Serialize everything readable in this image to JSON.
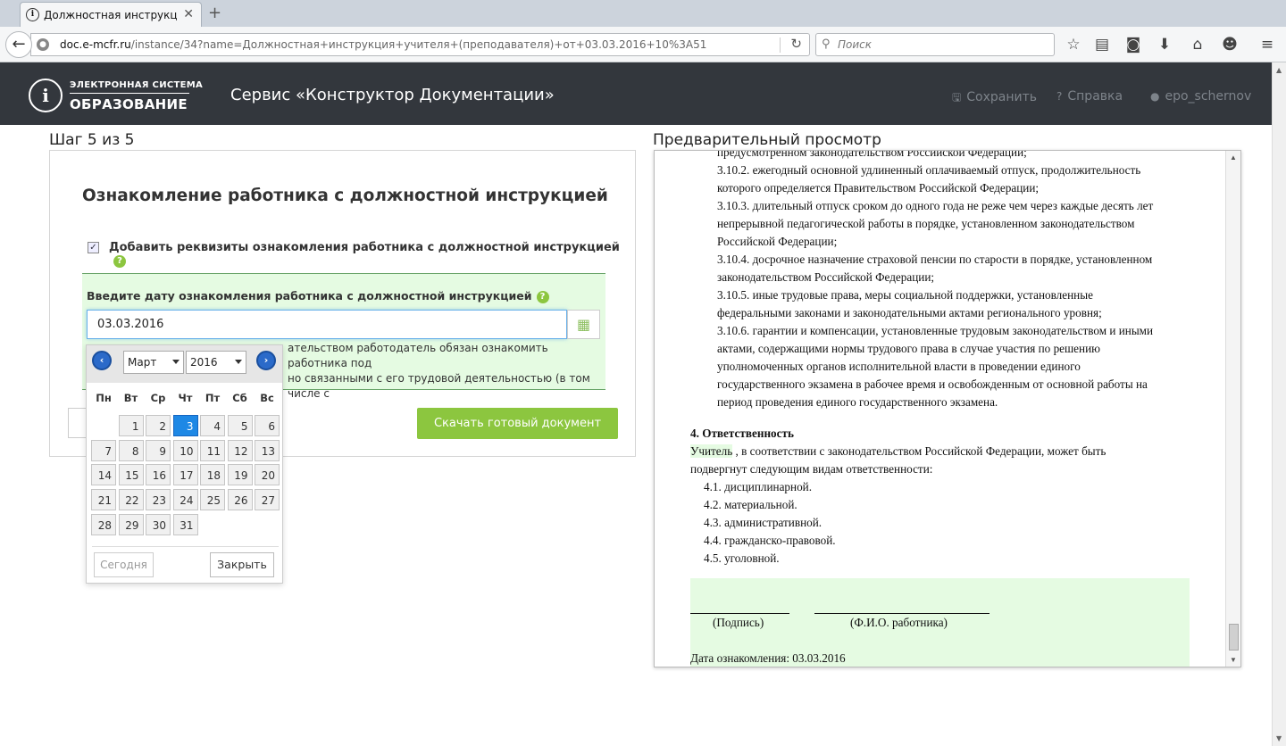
{
  "browser": {
    "tab_title": "Должностная инструкция...",
    "url_domain": "doc.e-mcfr.ru",
    "url_path": "/instance/34?name=Должностная+инструкция+учителя+(преподавателя)+от+03.03.2016+10%3A51",
    "search_placeholder": "Поиск"
  },
  "header": {
    "logo_top": "ЭЛЕКТРОННАЯ СИСТЕМА",
    "logo_bottom": "ОБРАЗОВАНИЕ",
    "service_title": "Сервис «Конструктор Документации»",
    "save": "Сохранить",
    "help": "Справка",
    "user": "epo_schernov"
  },
  "wizard": {
    "step": "Шаг 5 из 5",
    "title": "Ознакомление работника с должностной инструкцией",
    "checkbox_label": "Добавить реквизиты ознакомления работника с должностной инструкцией",
    "checkbox_checked": true,
    "date_label": "Введите дату ознакомления работника с должностной инструкцией",
    "date_value": "03.03.2016",
    "hint_line1": "ательством работодатель обязан ознакомить работника под",
    "hint_line2": "но связанными с его трудовой деятельностью (в том числе с",
    "download_button": "Скачать готовый документ"
  },
  "calendar": {
    "month": "Март",
    "year": "2016",
    "weekdays": [
      "Пн",
      "Вт",
      "Ср",
      "Чт",
      "Пт",
      "Сб",
      "Вс"
    ],
    "days": [
      "1",
      "2",
      "3",
      "4",
      "5",
      "6",
      "7",
      "8",
      "9",
      "10",
      "11",
      "12",
      "13",
      "14",
      "15",
      "16",
      "17",
      "18",
      "19",
      "20",
      "21",
      "22",
      "23",
      "24",
      "25",
      "26",
      "27",
      "28",
      "29",
      "30",
      "31"
    ],
    "selected_day": "3",
    "today_button": "Сегодня",
    "close_button": "Закрыть"
  },
  "preview": {
    "title": "Предварительный просмотр",
    "lines": [
      "предусмотренном законодательством Российской Федерации;",
      "3.10.2.  ежегодный основной удлиненный оплачиваемый отпуск, продолжительность",
      "которого определяется Правительством Российской Федерации;",
      "3.10.3.  длительный отпуск сроком до одного года не реже чем через каждые десять лет",
      "непрерывной педагогической работы в порядке, установленном законодательством",
      "Российской Федерации;",
      "3.10.4.  досрочное назначение страховой пенсии по старости в порядке, установленном",
      "законодательством Российской Федерации;",
      "3.10.5.  иные трудовые права, меры социальной поддержки, установленные",
      "федеральными законами и законодательными актами регионального уровня;",
      "3.10.6.  гарантии и компенсации, установленные трудовым законодательством и иными",
      "актами, содержащими нормы трудового права в случае участия по решению",
      "уполномоченных органов исполнительной власти в проведении единого",
      "государственного экзамена в рабочее время и освобожденным от основной работы на",
      "период проведения единого государственного экзамена."
    ],
    "section_title": "4. Ответственность",
    "resp_word": "Учитель",
    "resp_line1": " , в соответствии с законодательством Российской Федерации, может быть",
    "resp_line2": "подвергнут следующим видам ответственности:",
    "items": [
      "4.1.  дисциплинарной.",
      "4.2.  материальной.",
      "4.3.  административной.",
      "4.4.  гражданско-правовой.",
      "4.5.  уголовной."
    ],
    "sign_label": "(Подпись)",
    "fio_label": "(Ф.И.О. работника)",
    "date_line": "Дата ознакомления: 03.03.2016"
  },
  "colors": {
    "header_bg": "#33373d",
    "accent_green": "#8cc63f",
    "highlight": "#e5fbe2",
    "calendar_selected": "#1e88e5"
  }
}
